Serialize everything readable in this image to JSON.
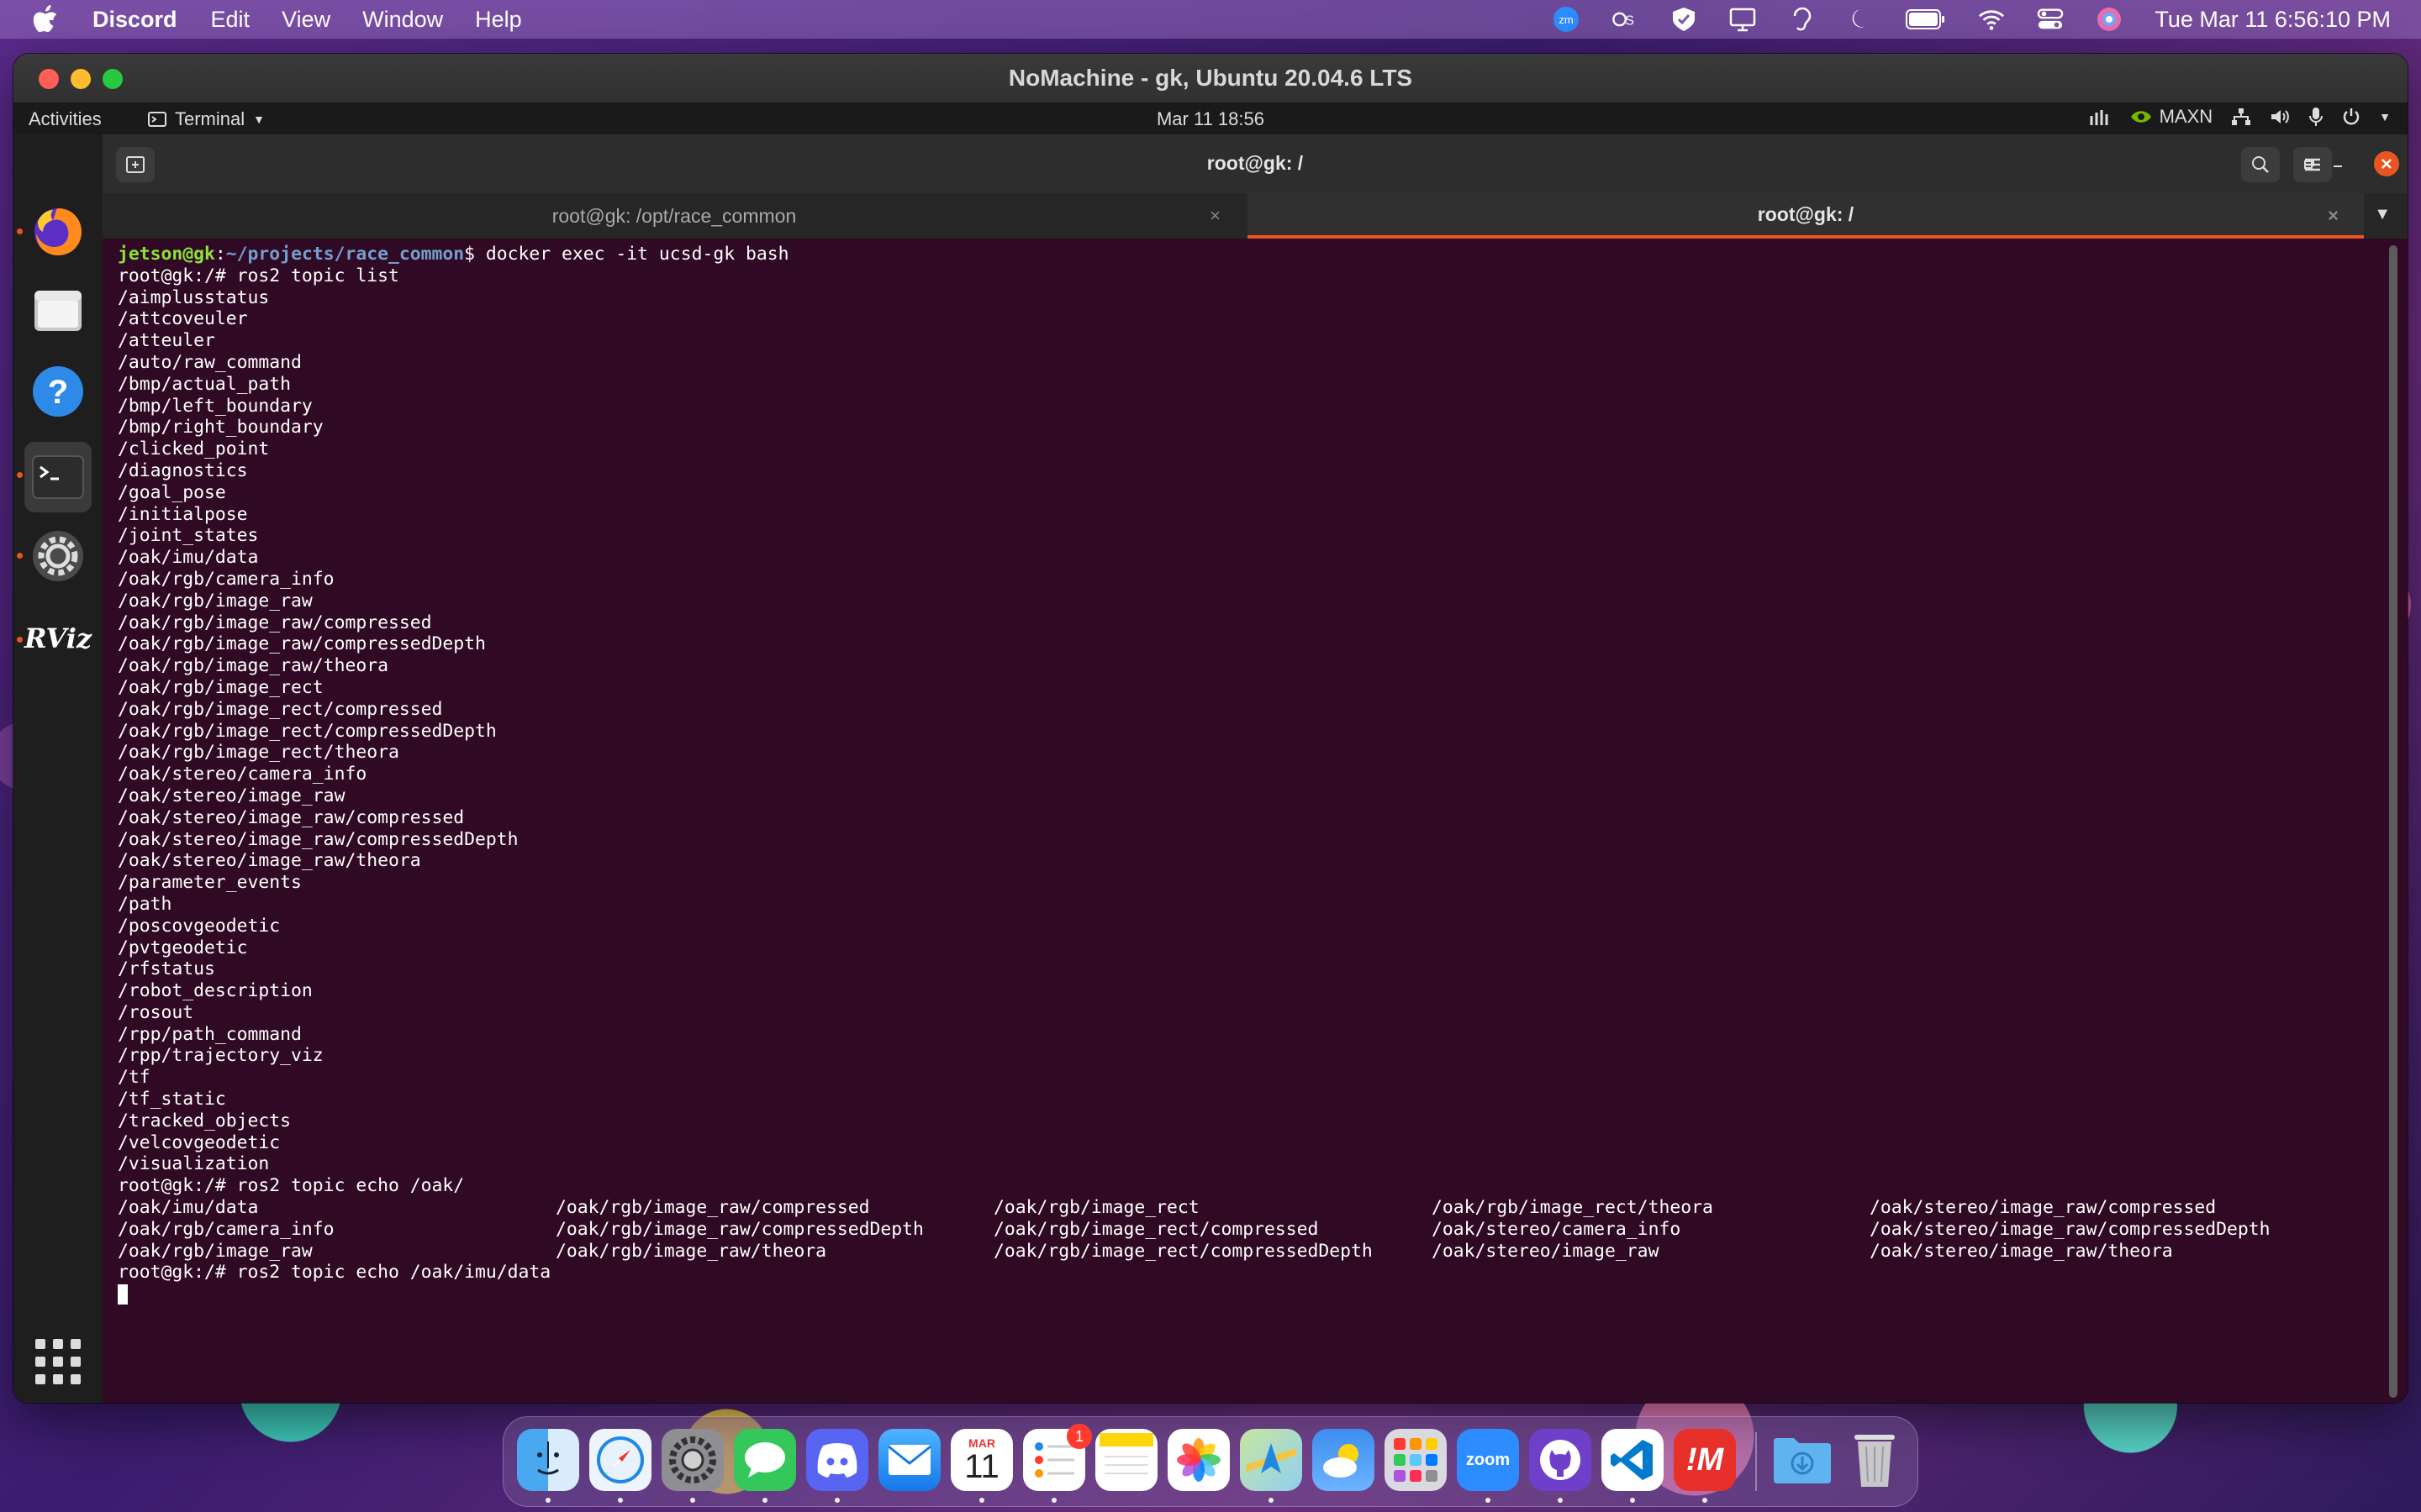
{
  "menubar": {
    "app": "Discord",
    "menus": [
      "Edit",
      "View",
      "Window",
      "Help"
    ],
    "clock": "Tue Mar 11  6:56:10 PM"
  },
  "window": {
    "title": "NoMachine - gk, Ubuntu 20.04.6 LTS"
  },
  "ubuntu_bar": {
    "activities": "Activities",
    "app_menu": "Terminal",
    "datetime": "Mar 11  18:56",
    "gpu_mode": "MAXN"
  },
  "terminal": {
    "title": "root@gk: /",
    "tabs": [
      {
        "label": "root@gk: /opt/race_common"
      },
      {
        "label": "root@gk: /"
      }
    ],
    "prompt_user": "jetson@gk",
    "prompt_path": "~/projects/race_common",
    "first_command": "$ docker exec -it ucsd-gk bash",
    "lines": [
      "root@gk:/# ros2 topic list",
      "/aimplusstatus",
      "/attcoveuler",
      "/atteuler",
      "/auto/raw_command",
      "/bmp/actual_path",
      "/bmp/left_boundary",
      "/bmp/right_boundary",
      "/clicked_point",
      "/diagnostics",
      "/goal_pose",
      "/initialpose",
      "/joint_states",
      "/oak/imu/data",
      "/oak/rgb/camera_info",
      "/oak/rgb/image_raw",
      "/oak/rgb/image_raw/compressed",
      "/oak/rgb/image_raw/compressedDepth",
      "/oak/rgb/image_raw/theora",
      "/oak/rgb/image_rect",
      "/oak/rgb/image_rect/compressed",
      "/oak/rgb/image_rect/compressedDepth",
      "/oak/rgb/image_rect/theora",
      "/oak/stereo/camera_info",
      "/oak/stereo/image_raw",
      "/oak/stereo/image_raw/compressed",
      "/oak/stereo/image_raw/compressedDepth",
      "/oak/stereo/image_raw/theora",
      "/parameter_events",
      "/path",
      "/poscovgeodetic",
      "/pvtgeodetic",
      "/rfstatus",
      "/robot_description",
      "/rosout",
      "/rpp/path_command",
      "/rpp/trajectory_viz",
      "/tf",
      "/tf_static",
      "/tracked_objects",
      "/velcovgeodetic",
      "/visualization",
      "root@gk:/# ros2 topic echo /oak/"
    ],
    "completions": [
      [
        "/oak/imu/data",
        "/oak/rgb/image_raw/compressed",
        "/oak/rgb/image_rect",
        "/oak/rgb/image_rect/theora",
        "/oak/stereo/image_raw/compressed"
      ],
      [
        "/oak/rgb/camera_info",
        "/oak/rgb/image_raw/compressedDepth",
        "/oak/rgb/image_rect/compressed",
        "/oak/stereo/camera_info",
        "/oak/stereo/image_raw/compressedDepth"
      ],
      [
        "/oak/rgb/image_raw",
        "/oak/rgb/image_raw/theora",
        "/oak/rgb/image_rect/compressedDepth",
        "/oak/stereo/image_raw",
        "/oak/stereo/image_raw/theora"
      ]
    ],
    "last_command": "root@gk:/# ros2 topic echo /oak/imu/data"
  },
  "ubuntu_dock": [
    "firefox-icon",
    "files-icon",
    "help-icon",
    "terminal-icon",
    "settings-icon",
    "rviz-icon"
  ],
  "rviz_label": "RViz",
  "mac_dock": {
    "calendar_month": "MAR",
    "calendar_day": "11",
    "reminders_badge": "1",
    "zoom_label": "zoom",
    "nomachine_label": "!M"
  },
  "colors": {
    "terminal_bg": "#300a24",
    "prompt_user": "#8ae234",
    "prompt_path": "#729fcf",
    "accent": "#e95420"
  }
}
